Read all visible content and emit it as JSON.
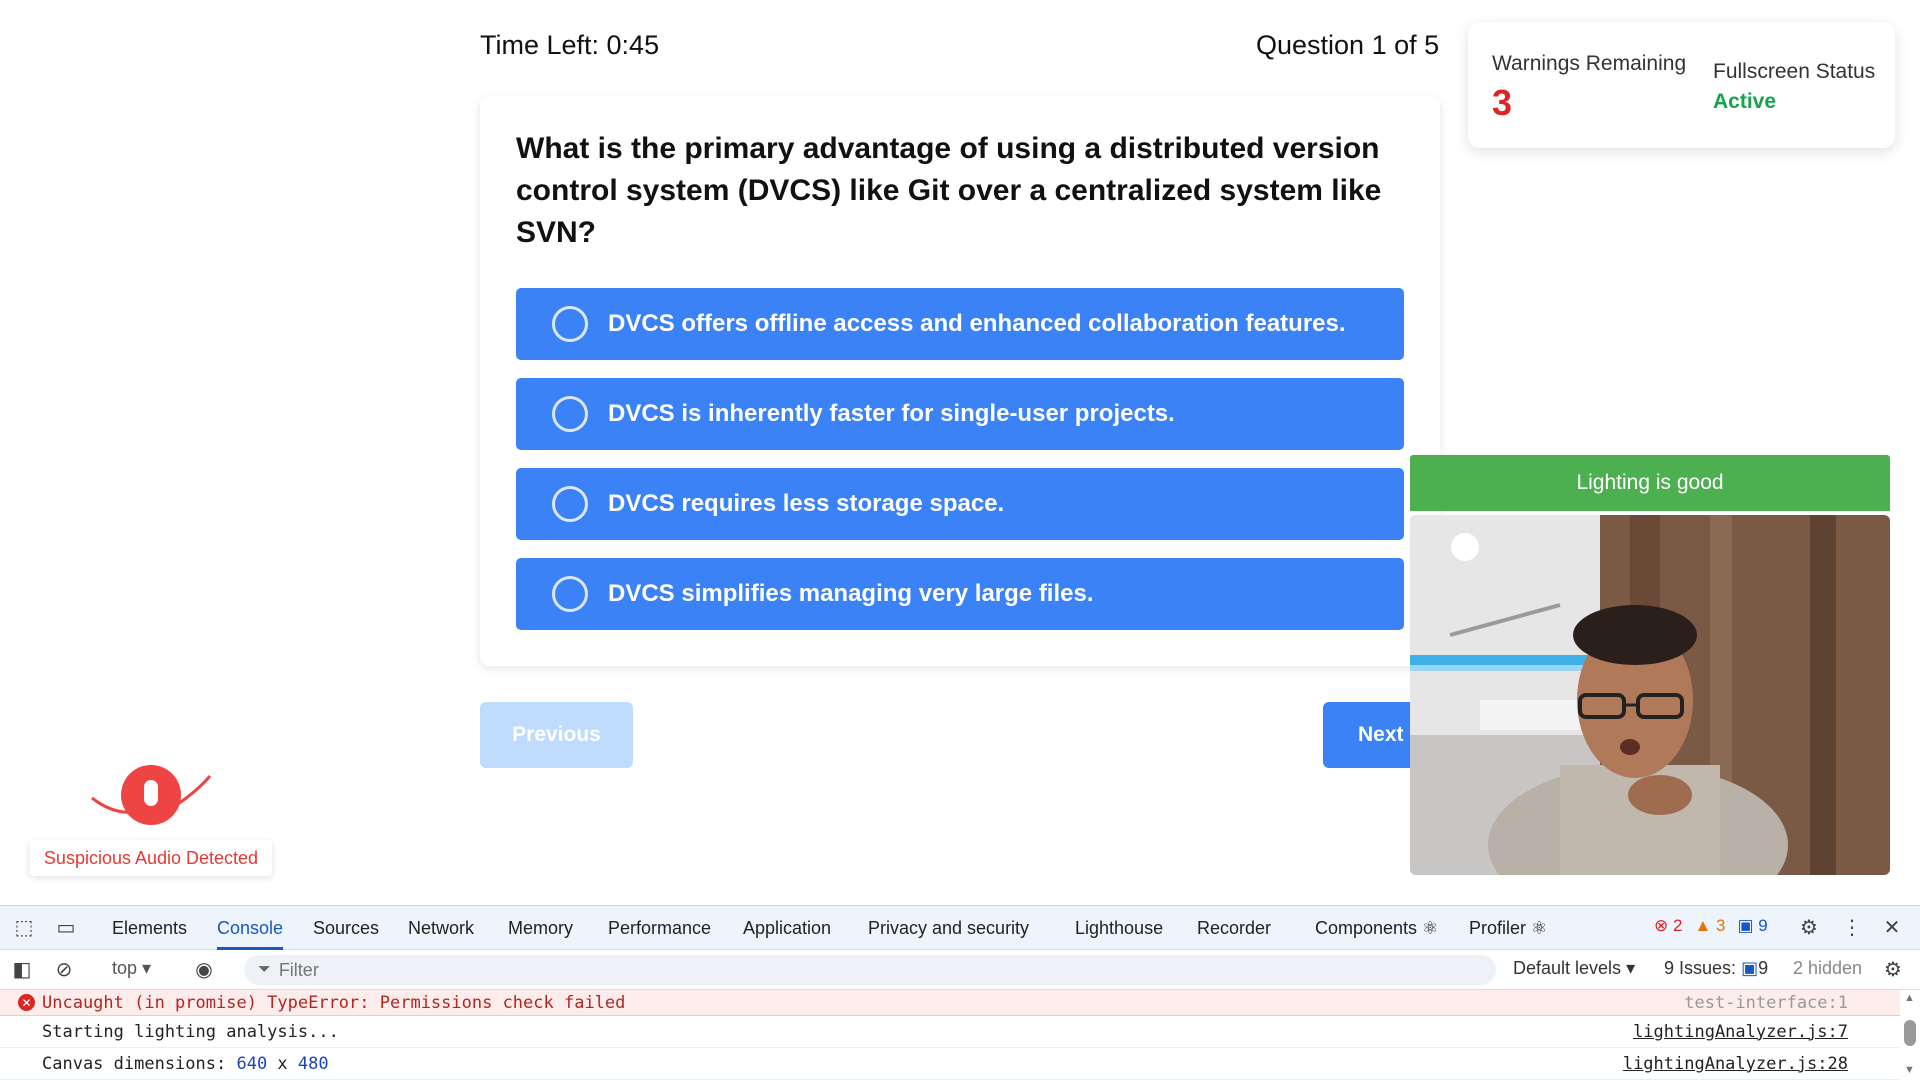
{
  "quiz": {
    "timer_label": "Time Left: 0:45",
    "progress_label": "Question 1 of 5",
    "question": "What is the primary advantage of using a distributed version control system (DVCS) like Git over a centralized system like SVN?",
    "options": [
      "DVCS offers offline access and enhanced collaboration features.",
      "DVCS is inherently faster for single-user projects.",
      "DVCS requires less storage space.",
      "DVCS simplifies managing very large files."
    ],
    "prev_label": "Previous",
    "next_label": "Next"
  },
  "status": {
    "warnings_label": "Warnings Remaining",
    "warnings_count": "3",
    "fullscreen_label": "Fullscreen Status",
    "fullscreen_value": "Active"
  },
  "webcam": {
    "lighting_text": "Lighting is good"
  },
  "audio": {
    "alert_text": "Suspicious Audio Detected"
  },
  "devtools": {
    "tabs": [
      "Elements",
      "Console",
      "Sources",
      "Network",
      "Memory",
      "Performance",
      "Application",
      "Privacy and security",
      "Lighthouse",
      "Recorder",
      "Components ⚛",
      "Profiler ⚛"
    ],
    "active_tab": "Console",
    "error_count": "2",
    "warning_count": "3",
    "info_count": "9",
    "context": "top",
    "filter_placeholder": "Filter",
    "levels": "Default levels",
    "issues_label": "9 Issues:",
    "issues_count": "9",
    "hidden_label": "2 hidden",
    "logs": [
      {
        "type": "error",
        "message": "Uncaught (in promise) TypeError: Permissions check failed",
        "source": "test-interface:1"
      },
      {
        "type": "log",
        "message": "Starting lighting analysis...",
        "source": "lightingAnalyzer.js:7"
      },
      {
        "type": "log",
        "message_prefix": "Canvas dimensions: ",
        "width": "640",
        "x_sep": " x ",
        "height": "480",
        "source": "lightingAnalyzer.js:28"
      }
    ]
  },
  "colors": {
    "option_blue": "#3b82f6",
    "prev_disabled": "#bfdbfe",
    "warning_red": "#dc2626",
    "active_green": "#16a34a",
    "lighting_green": "#4caf50"
  }
}
